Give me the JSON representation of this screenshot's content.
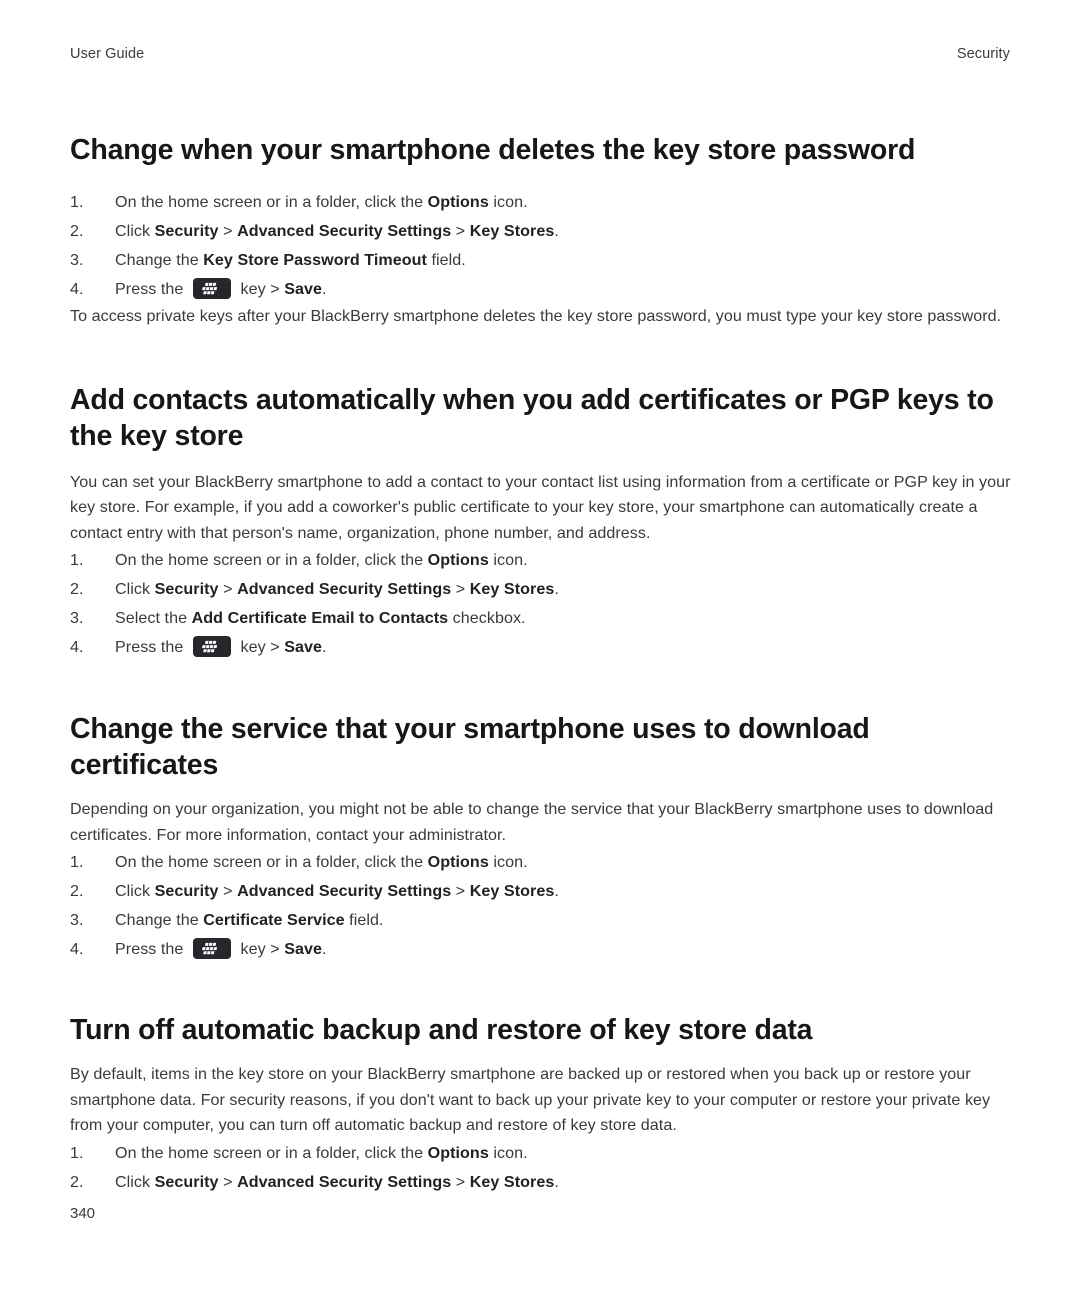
{
  "header": {
    "left_label": "User Guide",
    "right_label": "Security"
  },
  "footer": {
    "page_number": "340"
  },
  "icons": {
    "menu_key": "blackberry-menu-key-icon"
  },
  "colors": {
    "heading": "#17171a",
    "body_text": "#3a3a3a",
    "bold_text": "#222225",
    "key_icon_background": "#26262b",
    "page_background": "#ffffff"
  },
  "sections": [
    {
      "id": "change-key-store-password-deletion",
      "heading": "Change when your smartphone deletes the key store password",
      "steps": [
        {
          "marker": "1.",
          "parts": [
            {
              "type": "text",
              "value": "On the home screen or in a folder, click the "
            },
            {
              "type": "bold",
              "value": "Options"
            },
            {
              "type": "text",
              "value": " icon."
            }
          ]
        },
        {
          "marker": "2.",
          "parts": [
            {
              "type": "text",
              "value": "Click "
            },
            {
              "type": "bold",
              "value": "Security"
            },
            {
              "type": "text",
              "value": " > "
            },
            {
              "type": "bold",
              "value": "Advanced Security Settings"
            },
            {
              "type": "text",
              "value": " > "
            },
            {
              "type": "bold",
              "value": "Key Stores"
            },
            {
              "type": "text",
              "value": "."
            }
          ]
        },
        {
          "marker": "3.",
          "parts": [
            {
              "type": "text",
              "value": "Change the "
            },
            {
              "type": "bold",
              "value": "Key Store Password Timeout"
            },
            {
              "type": "text",
              "value": " field."
            }
          ]
        },
        {
          "marker": "4.",
          "parts": [
            {
              "type": "text",
              "value": "Press the "
            },
            {
              "type": "key-icon",
              "value": "blackberry-menu-key-icon"
            },
            {
              "type": "text",
              "value": " key > "
            },
            {
              "type": "bold",
              "value": "Save"
            },
            {
              "type": "text",
              "value": "."
            }
          ]
        }
      ],
      "trailing_paragraph": "To access private keys after your BlackBerry smartphone deletes the key store password, you must type your key store password."
    },
    {
      "id": "add-contacts-automatically",
      "heading": "Add contacts automatically when you add certificates or PGP keys to the key store",
      "intro_paragraph": "You can set your BlackBerry smartphone to add a contact to your contact list using information from a certificate or PGP key in your key store. For example, if you add a coworker's public certificate to your key store, your smartphone can automatically create a contact entry with that person's name, organization, phone number, and address.",
      "steps": [
        {
          "marker": "1.",
          "parts": [
            {
              "type": "text",
              "value": "On the home screen or in a folder, click the "
            },
            {
              "type": "bold",
              "value": "Options"
            },
            {
              "type": "text",
              "value": " icon."
            }
          ]
        },
        {
          "marker": "2.",
          "parts": [
            {
              "type": "text",
              "value": "Click "
            },
            {
              "type": "bold",
              "value": "Security"
            },
            {
              "type": "text",
              "value": " > "
            },
            {
              "type": "bold",
              "value": "Advanced Security Settings"
            },
            {
              "type": "text",
              "value": " > "
            },
            {
              "type": "bold",
              "value": "Key Stores"
            },
            {
              "type": "text",
              "value": "."
            }
          ]
        },
        {
          "marker": "3.",
          "parts": [
            {
              "type": "text",
              "value": "Select the "
            },
            {
              "type": "bold",
              "value": "Add Certificate Email to Contacts"
            },
            {
              "type": "text",
              "value": " checkbox."
            }
          ]
        },
        {
          "marker": "4.",
          "parts": [
            {
              "type": "text",
              "value": "Press the "
            },
            {
              "type": "key-icon",
              "value": "blackberry-menu-key-icon"
            },
            {
              "type": "text",
              "value": " key > "
            },
            {
              "type": "bold",
              "value": "Save"
            },
            {
              "type": "text",
              "value": "."
            }
          ]
        }
      ]
    },
    {
      "id": "change-certificate-download-service",
      "heading": "Change the service that your smartphone uses to download certificates",
      "intro_paragraph": "Depending on your organization, you might not be able to change the service that your BlackBerry smartphone uses to download certificates. For more information, contact your administrator.",
      "steps": [
        {
          "marker": "1.",
          "parts": [
            {
              "type": "text",
              "value": "On the home screen or in a folder, click the "
            },
            {
              "type": "bold",
              "value": "Options"
            },
            {
              "type": "text",
              "value": " icon."
            }
          ]
        },
        {
          "marker": "2.",
          "parts": [
            {
              "type": "text",
              "value": "Click "
            },
            {
              "type": "bold",
              "value": "Security"
            },
            {
              "type": "text",
              "value": " > "
            },
            {
              "type": "bold",
              "value": "Advanced Security Settings"
            },
            {
              "type": "text",
              "value": " > "
            },
            {
              "type": "bold",
              "value": "Key Stores"
            },
            {
              "type": "text",
              "value": "."
            }
          ]
        },
        {
          "marker": "3.",
          "parts": [
            {
              "type": "text",
              "value": "Change the "
            },
            {
              "type": "bold",
              "value": "Certificate Service"
            },
            {
              "type": "text",
              "value": " field."
            }
          ]
        },
        {
          "marker": "4.",
          "parts": [
            {
              "type": "text",
              "value": "Press the "
            },
            {
              "type": "key-icon",
              "value": "blackberry-menu-key-icon"
            },
            {
              "type": "text",
              "value": " key > "
            },
            {
              "type": "bold",
              "value": "Save"
            },
            {
              "type": "text",
              "value": "."
            }
          ]
        }
      ]
    },
    {
      "id": "turn-off-key-store-backup",
      "heading": "Turn off automatic backup and restore of key store data",
      "intro_paragraph": "By default, items in the key store on your BlackBerry smartphone are backed up or restored when you back up or restore your smartphone data. For security reasons, if you don't want to back up your private key to your computer or restore your private key from your computer, you can turn off automatic backup and restore of key store data.",
      "steps": [
        {
          "marker": "1.",
          "parts": [
            {
              "type": "text",
              "value": "On the home screen or in a folder, click the "
            },
            {
              "type": "bold",
              "value": "Options"
            },
            {
              "type": "text",
              "value": " icon."
            }
          ]
        },
        {
          "marker": "2.",
          "parts": [
            {
              "type": "text",
              "value": "Click "
            },
            {
              "type": "bold",
              "value": "Security"
            },
            {
              "type": "text",
              "value": " > "
            },
            {
              "type": "bold",
              "value": "Advanced Security Settings"
            },
            {
              "type": "text",
              "value": " > "
            },
            {
              "type": "bold",
              "value": "Key Stores"
            },
            {
              "type": "text",
              "value": "."
            }
          ]
        }
      ]
    }
  ]
}
